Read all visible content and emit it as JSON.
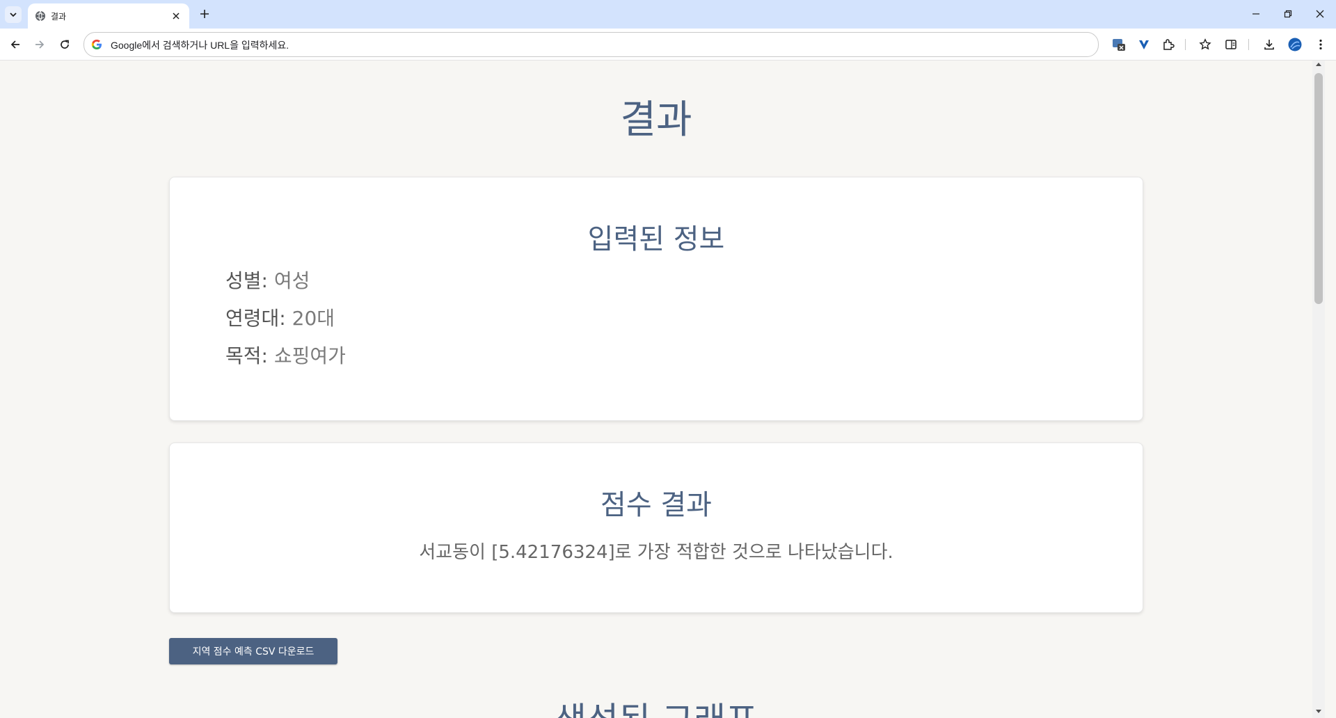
{
  "browser": {
    "tab_title": "결과",
    "omnibox_placeholder": "Google에서 검색하거나 URL을 입력하세요."
  },
  "page": {
    "title": "결과",
    "info_card": {
      "heading": "입력된 정보",
      "rows": [
        {
          "label": "성별:",
          "value": "여성"
        },
        {
          "label": "연령대:",
          "value": "20대"
        },
        {
          "label": "목적:",
          "value": "쇼핑여가"
        }
      ]
    },
    "score_card": {
      "heading": "점수 결과",
      "result_text": "서교동이 [5.42176324]로 가장 적합한 것으로 나타났습니다."
    },
    "csv_button_label": "지역 점수 예측 CSV 다운로드",
    "graph_section_title": "생성된 그래프"
  },
  "colors": {
    "accent": "#4c6282",
    "page_bg": "#f7f6f3",
    "tabstrip_bg": "#d3e3fd"
  }
}
